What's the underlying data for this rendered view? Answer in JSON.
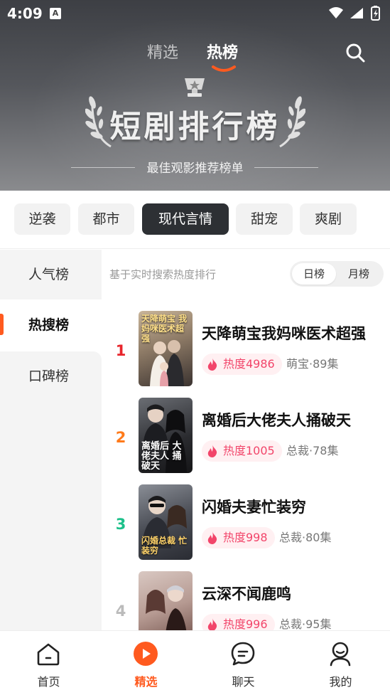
{
  "status": {
    "time": "4:09",
    "a_badge": "A"
  },
  "header": {
    "tabs": [
      {
        "label": "精选"
      },
      {
        "label": "热榜"
      }
    ],
    "active_tab": "热榜"
  },
  "hero": {
    "title": "短剧排行榜",
    "subtitle": "最佳观影推荐榜单"
  },
  "categories": [
    {
      "label": "逆袭"
    },
    {
      "label": "都市"
    },
    {
      "label": "现代言情"
    },
    {
      "label": "甜宠"
    },
    {
      "label": "爽剧"
    }
  ],
  "active_category": "现代言情",
  "side_nav": [
    {
      "label": "人气榜"
    },
    {
      "label": "热搜榜"
    },
    {
      "label": "口碑榜"
    }
  ],
  "active_side": "热搜榜",
  "list_hint": "基于实时搜索热度排行",
  "period_toggle": {
    "options": [
      "日榜",
      "月榜"
    ],
    "selected": "日榜"
  },
  "dramas": [
    {
      "rank": "1",
      "title": "天降萌宝我妈咪医术超强",
      "heat": "热度4986",
      "meta": "萌宝·89集",
      "cover_text": "天降萌宝 我妈咪医术超强",
      "rank_color": "#e8262c"
    },
    {
      "rank": "2",
      "title": "离婚后大佬夫人捅破天",
      "heat": "热度1005",
      "meta": "总裁·78集",
      "cover_text": "离婚后 大佬夫人 捅破天",
      "rank_color": "#ff7a1a"
    },
    {
      "rank": "3",
      "title": "闪婚夫妻忙装穷",
      "heat": "热度998",
      "meta": "总裁·80集",
      "cover_text": "闪婚总裁 忙装穷",
      "rank_color": "#1cc08a"
    },
    {
      "rank": "4",
      "title": "云深不闻鹿鸣",
      "heat": "热度996",
      "meta": "总裁·95集",
      "cover_text": "",
      "rank_color": "#bbbbbb"
    }
  ],
  "bottom_nav": [
    {
      "label": "首页",
      "icon": "home-icon"
    },
    {
      "label": "精选",
      "icon": "play-icon"
    },
    {
      "label": "聊天",
      "icon": "chat-icon"
    },
    {
      "label": "我的",
      "icon": "profile-icon"
    }
  ],
  "active_bottom": "精选",
  "colors": {
    "accent": "#ff5a1f",
    "heat_text": "#f2456a",
    "chip_active": "#2d3034"
  }
}
